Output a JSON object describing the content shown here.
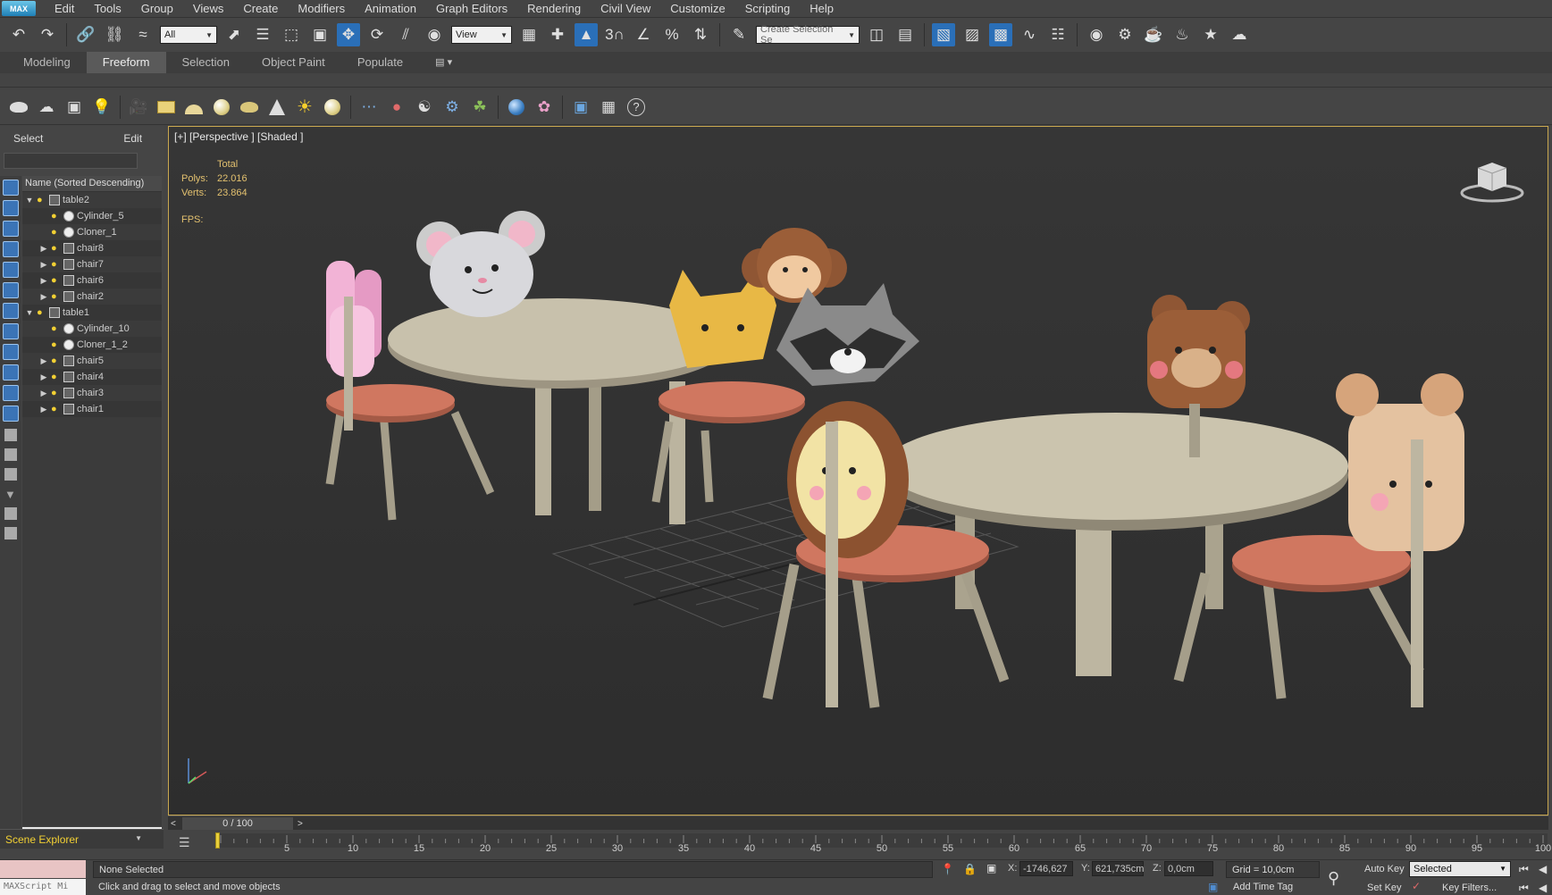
{
  "app": {
    "logo": "MAX"
  },
  "menu": [
    "Edit",
    "Tools",
    "Group",
    "Views",
    "Create",
    "Modifiers",
    "Animation",
    "Graph Editors",
    "Rendering",
    "Civil View",
    "Customize",
    "Scripting",
    "Help"
  ],
  "toolbar": {
    "selection_filter": "All",
    "ref_coord": "View",
    "snap_label": "3",
    "named_selection_placeholder": "Create Selection Se"
  },
  "ribbon": {
    "tabs": [
      "Modeling",
      "Freeform",
      "Selection",
      "Object Paint",
      "Populate"
    ],
    "active_tab": "Freeform"
  },
  "left_panel": {
    "tabs": [
      "Select",
      "Edit"
    ],
    "column_header": "Name (Sorted Descending)",
    "tree": [
      {
        "name": "table2",
        "level": 0,
        "expand": "open",
        "type": "group"
      },
      {
        "name": "Cylinder_5",
        "level": 1,
        "expand": "none",
        "type": "sphere"
      },
      {
        "name": "Cloner_1",
        "level": 1,
        "expand": "none",
        "type": "sphere"
      },
      {
        "name": "chair8",
        "level": 1,
        "expand": "closed",
        "type": "group"
      },
      {
        "name": "chair7",
        "level": 1,
        "expand": "closed",
        "type": "group"
      },
      {
        "name": "chair6",
        "level": 1,
        "expand": "closed",
        "type": "group"
      },
      {
        "name": "chair2",
        "level": 1,
        "expand": "closed",
        "type": "group"
      },
      {
        "name": "table1",
        "level": 0,
        "expand": "open",
        "type": "group"
      },
      {
        "name": "Cylinder_10",
        "level": 1,
        "expand": "none",
        "type": "sphere"
      },
      {
        "name": "Cloner_1_2",
        "level": 1,
        "expand": "none",
        "type": "sphere"
      },
      {
        "name": "chair5",
        "level": 1,
        "expand": "closed",
        "type": "group"
      },
      {
        "name": "chair4",
        "level": 1,
        "expand": "closed",
        "type": "group"
      },
      {
        "name": "chair3",
        "level": 1,
        "expand": "closed",
        "type": "group"
      },
      {
        "name": "chair1",
        "level": 1,
        "expand": "closed",
        "type": "group"
      }
    ],
    "footer": "Scene Explorer"
  },
  "viewport": {
    "label": "[+] [Perspective ] [Shaded ]",
    "stats_title": "Total",
    "polys_label": "Polys:",
    "polys": "22.016",
    "verts_label": "Verts:",
    "verts": "23.864",
    "fps_label": "FPS:",
    "frame_color": "#c9a84f"
  },
  "timeline": {
    "frame_display": "0 / 100",
    "ticks": [
      "5",
      "10",
      "15",
      "20",
      "25",
      "30",
      "35",
      "40",
      "45",
      "50",
      "55",
      "60",
      "65",
      "70",
      "75",
      "80",
      "85",
      "90",
      "95",
      "100"
    ],
    "max_frame": 100
  },
  "status": {
    "maxscript": "MAXScript Mi",
    "selection": "None Selected",
    "prompt": "Click and drag to select and move objects",
    "x_label": "X:",
    "x": "-1746,627",
    "y_label": "Y:",
    "y": "621,735cm",
    "z_label": "Z:",
    "z": "0,0cm",
    "grid": "Grid = 10,0cm",
    "add_time_tag": "Add Time Tag",
    "auto_key": "Auto Key",
    "set_key": "Set Key",
    "key_mode": "Selected",
    "key_filters": "Key Filters..."
  }
}
